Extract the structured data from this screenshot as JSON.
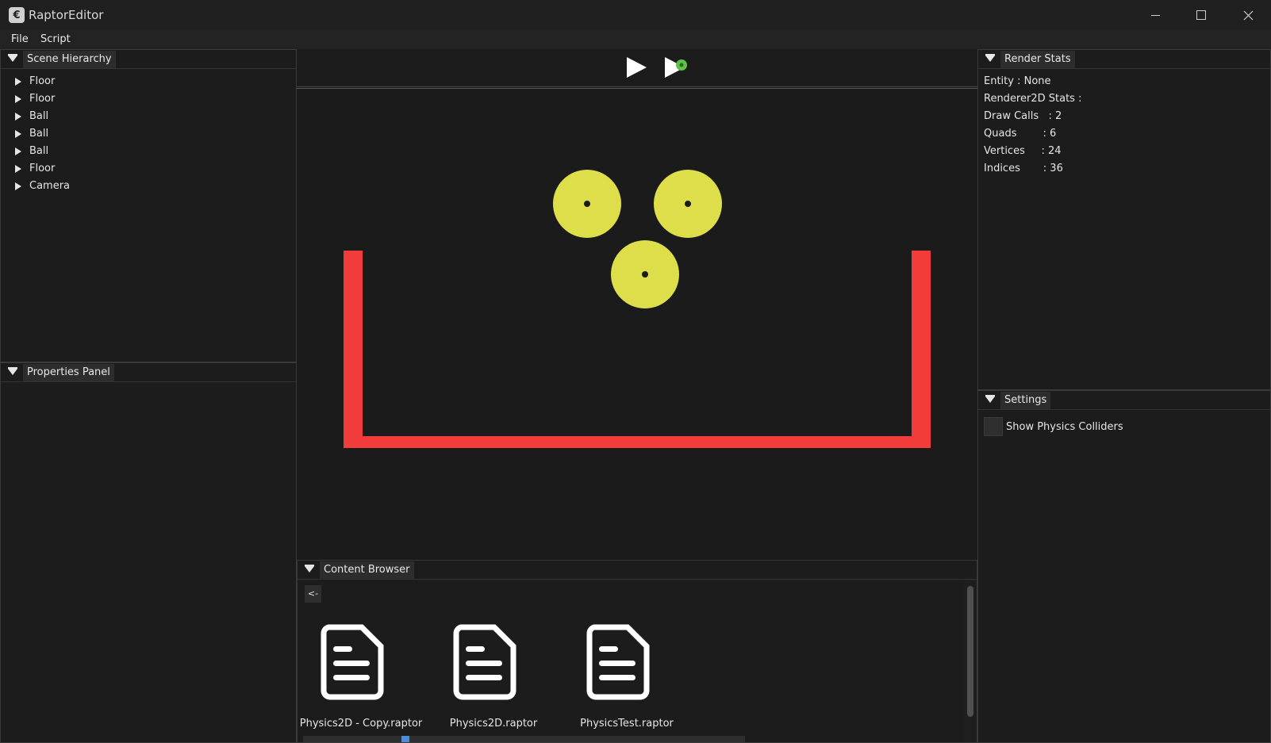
{
  "window": {
    "title": "RaptorEditor"
  },
  "menu": {
    "file": "File",
    "script": "Script"
  },
  "scene_hierarchy": {
    "title": "Scene Hierarchy",
    "items": [
      {
        "label": "Floor"
      },
      {
        "label": "Floor"
      },
      {
        "label": "Ball"
      },
      {
        "label": "Ball"
      },
      {
        "label": "Ball"
      },
      {
        "label": "Floor"
      },
      {
        "label": "Camera"
      }
    ]
  },
  "properties_panel": {
    "title": "Properties Panel"
  },
  "render_stats": {
    "title": "Render Stats",
    "lines": [
      "Entity : None",
      "Renderer2D Stats :",
      "Draw Calls   : 2",
      "Quads        : 6",
      "Vertices     : 24",
      "Indices       : 36"
    ]
  },
  "settings": {
    "title": "Settings",
    "show_physics_colliders_label": "Show Physics Colliders",
    "show_physics_colliders": false
  },
  "toolbar": {
    "play_icon": "play-icon",
    "simulate_icon": "simulate-icon"
  },
  "viewport": {
    "floor_color": "#f23c3c",
    "ball_color": "#dede4a",
    "background": "#1b1b1b"
  },
  "content_browser": {
    "title": "Content Browser",
    "back_label": "<-",
    "files": [
      {
        "name": "Physics2D - Copy.raptor",
        "icon": "file-icon"
      },
      {
        "name": "Physics2D.raptor",
        "icon": "file-icon"
      },
      {
        "name": "PhysicsTest.raptor",
        "icon": "file-icon"
      }
    ]
  }
}
